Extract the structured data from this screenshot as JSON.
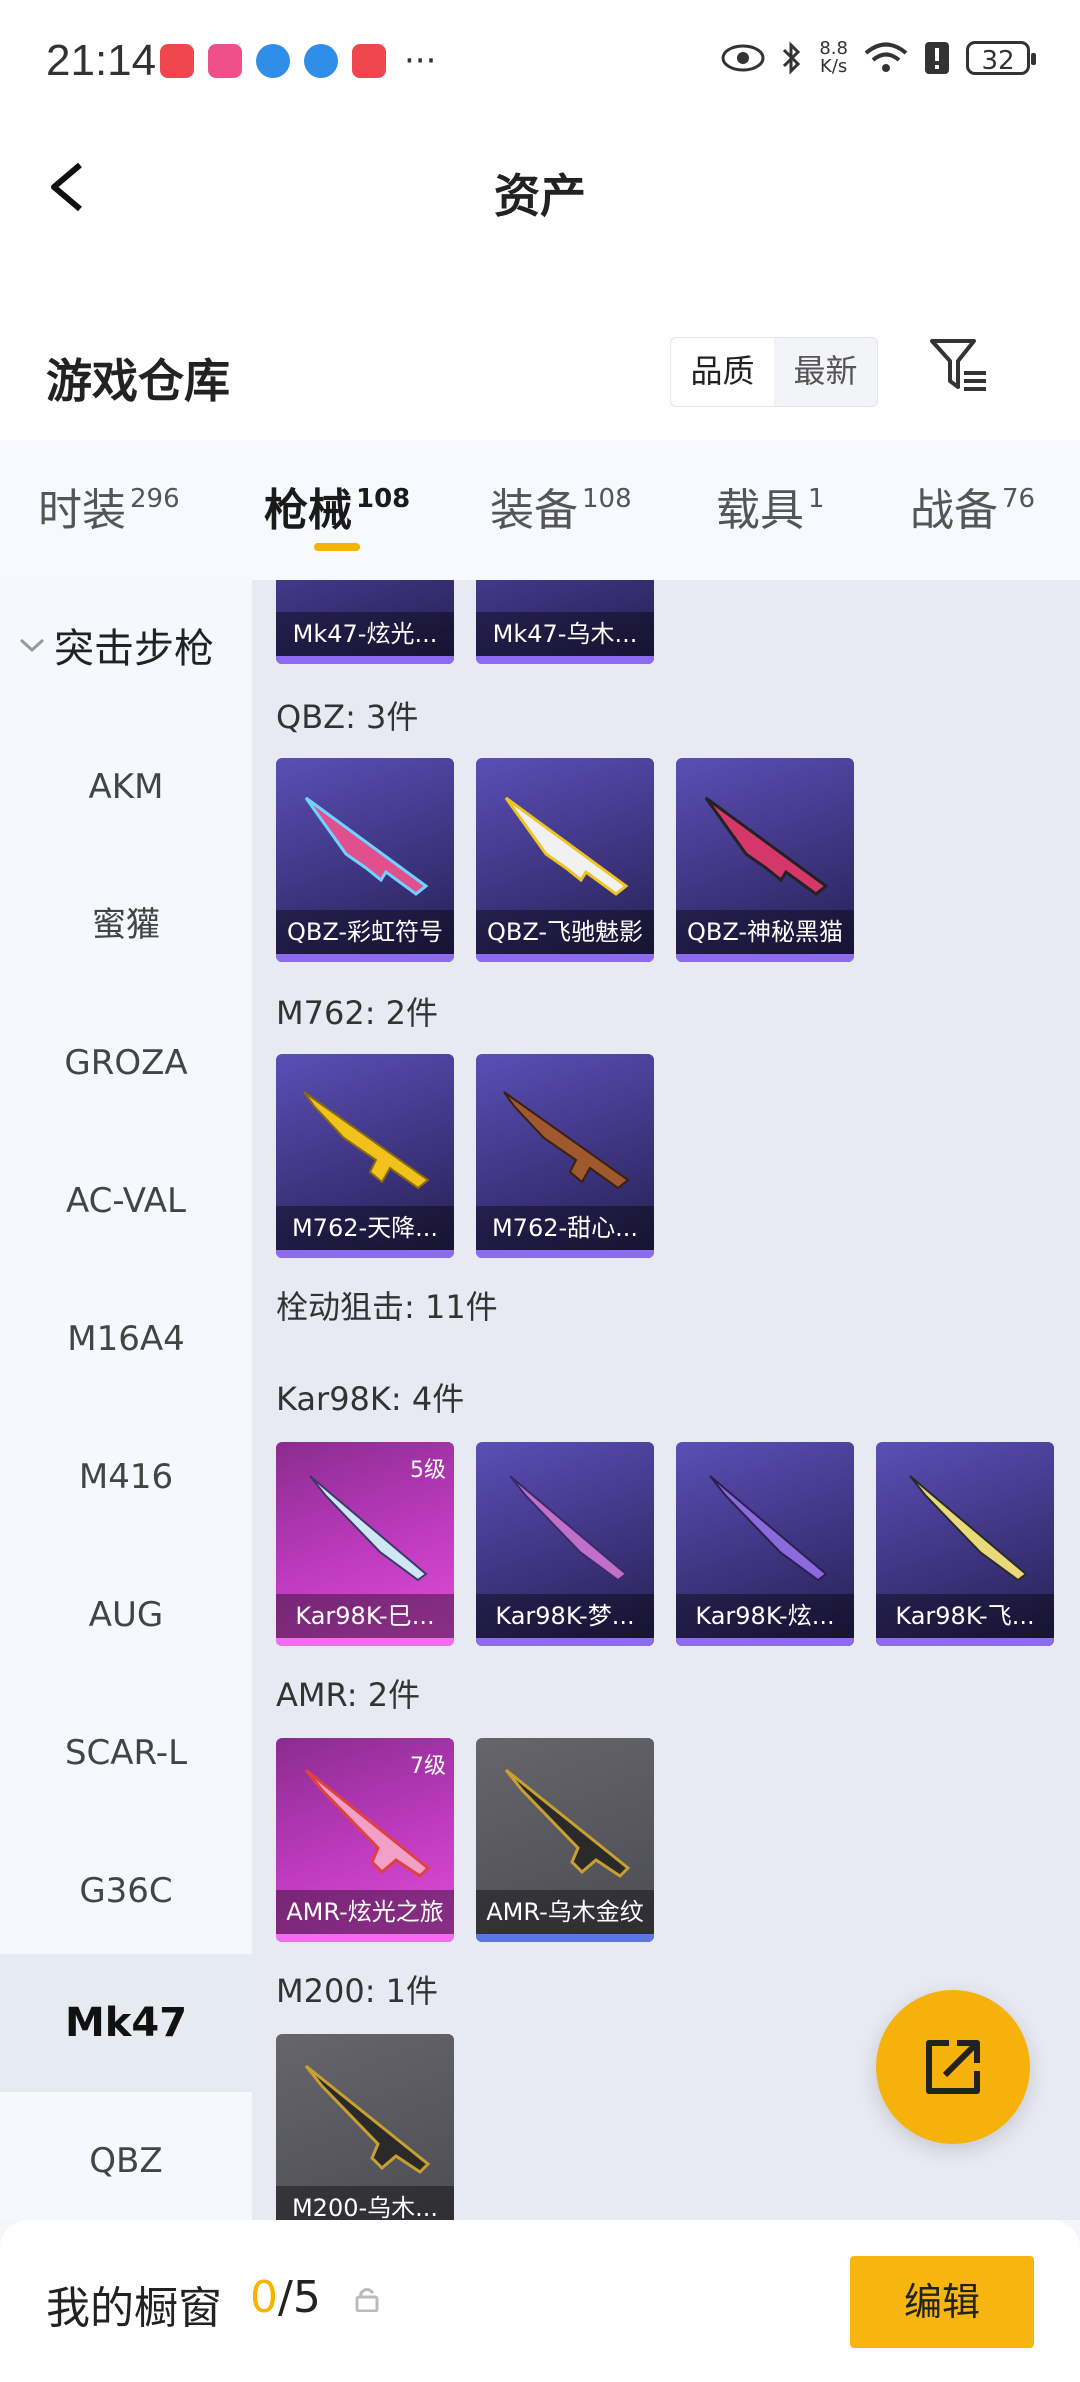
{
  "status_bar": {
    "time": "21:14",
    "net_speed_value": "8.8",
    "net_speed_unit": "K/s",
    "battery": "32"
  },
  "header": {
    "title": "资产"
  },
  "warehouse": {
    "title": "游戏仓库",
    "sort_options": [
      "品质",
      "最新"
    ],
    "sort_selected": "品质"
  },
  "tabs": [
    {
      "label": "时装",
      "count": "296"
    },
    {
      "label": "枪械",
      "count": "108"
    },
    {
      "label": "装备",
      "count": "108"
    },
    {
      "label": "载具",
      "count": "1"
    },
    {
      "label": "战备",
      "count": "76"
    }
  ],
  "active_tab": "枪械",
  "sidebar": {
    "group": "突击步枪",
    "items": [
      "AKM",
      "蜜獾",
      "GROZA",
      "AC-VAL",
      "M16A4",
      "M416",
      "AUG",
      "SCAR-L",
      "G36C",
      "Mk47",
      "QBZ"
    ],
    "active": "Mk47"
  },
  "content": {
    "partial_cards": [
      "Mk47-炫光...",
      "Mk47-乌木..."
    ],
    "groups": {
      "qbz": {
        "title": "QBZ: 3件",
        "cards": [
          "QBZ-彩虹符号",
          "QBZ-飞驰魅影",
          "QBZ-神秘黑猫"
        ]
      },
      "m762": {
        "title": "M762: 2件",
        "cards": [
          "M762-天降...",
          "M762-甜心..."
        ]
      },
      "bolt": {
        "title": "栓动狙击: 11件"
      },
      "kar98k": {
        "title": "Kar98K: 4件",
        "cards": [
          "Kar98K-巳...",
          "Kar98K-梦...",
          "Kar98K-炫...",
          "Kar98K-飞..."
        ],
        "level_first": "5级"
      },
      "amr": {
        "title": "AMR: 2件",
        "cards": [
          "AMR-炫光之旅",
          "AMR-乌木金纹"
        ],
        "level_first": "7级"
      },
      "m200": {
        "title": "M200: 1件",
        "cards": [
          "M200-乌木..."
        ]
      }
    }
  },
  "bottom": {
    "label": "我的橱窗",
    "current": "0",
    "total": "/5",
    "edit_label": "编辑"
  },
  "colors": {
    "accent": "#f5b400",
    "card_purple": "#4b3f9c",
    "card_pink": "#c03bc0",
    "card_grey": "#55555c"
  }
}
